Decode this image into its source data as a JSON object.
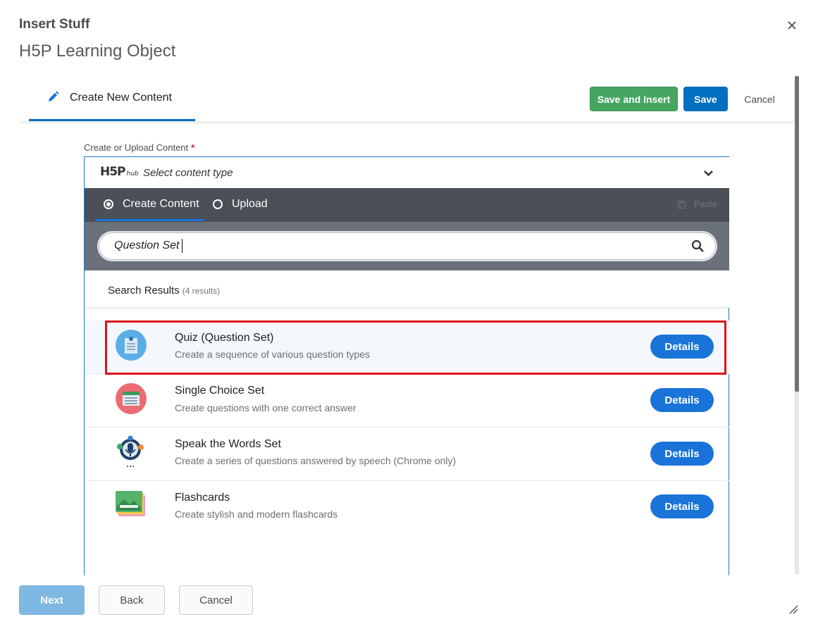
{
  "dialog": {
    "title": "Insert Stuff",
    "subtitle": "H5P Learning Object"
  },
  "tabs": {
    "active_label": "Create New Content",
    "save_insert_label": "Save and Insert",
    "save_label": "Save",
    "cancel_label": "Cancel"
  },
  "form": {
    "label": "Create or Upload Content",
    "required_mark": "*"
  },
  "hub": {
    "logo": "H5P",
    "logo_sub": "hub",
    "select_label": "Select content type",
    "nav_create": "Create Content",
    "nav_upload": "Upload",
    "paste_label": "Paste",
    "search_value": "Question Set",
    "results_title": "Search Results",
    "results_count": "(4 results)",
    "items": [
      {
        "title": "Quiz (Question Set)",
        "desc": "Create a sequence of various question types",
        "button": "Details"
      },
      {
        "title": "Single Choice Set",
        "desc": "Create questions with one correct answer",
        "button": "Details"
      },
      {
        "title": "Speak the Words Set",
        "desc": "Create a series of questions answered by speech (Chrome only)",
        "button": "Details"
      },
      {
        "title": "Flashcards",
        "desc": "Create stylish and modern flashcards",
        "button": "Details"
      }
    ]
  },
  "footer": {
    "next_label": "Next",
    "back_label": "Back",
    "cancel_label": "Cancel"
  },
  "colors": {
    "accent": "#006fbf",
    "green": "#46a661",
    "highlight_box": "#e0121d"
  }
}
